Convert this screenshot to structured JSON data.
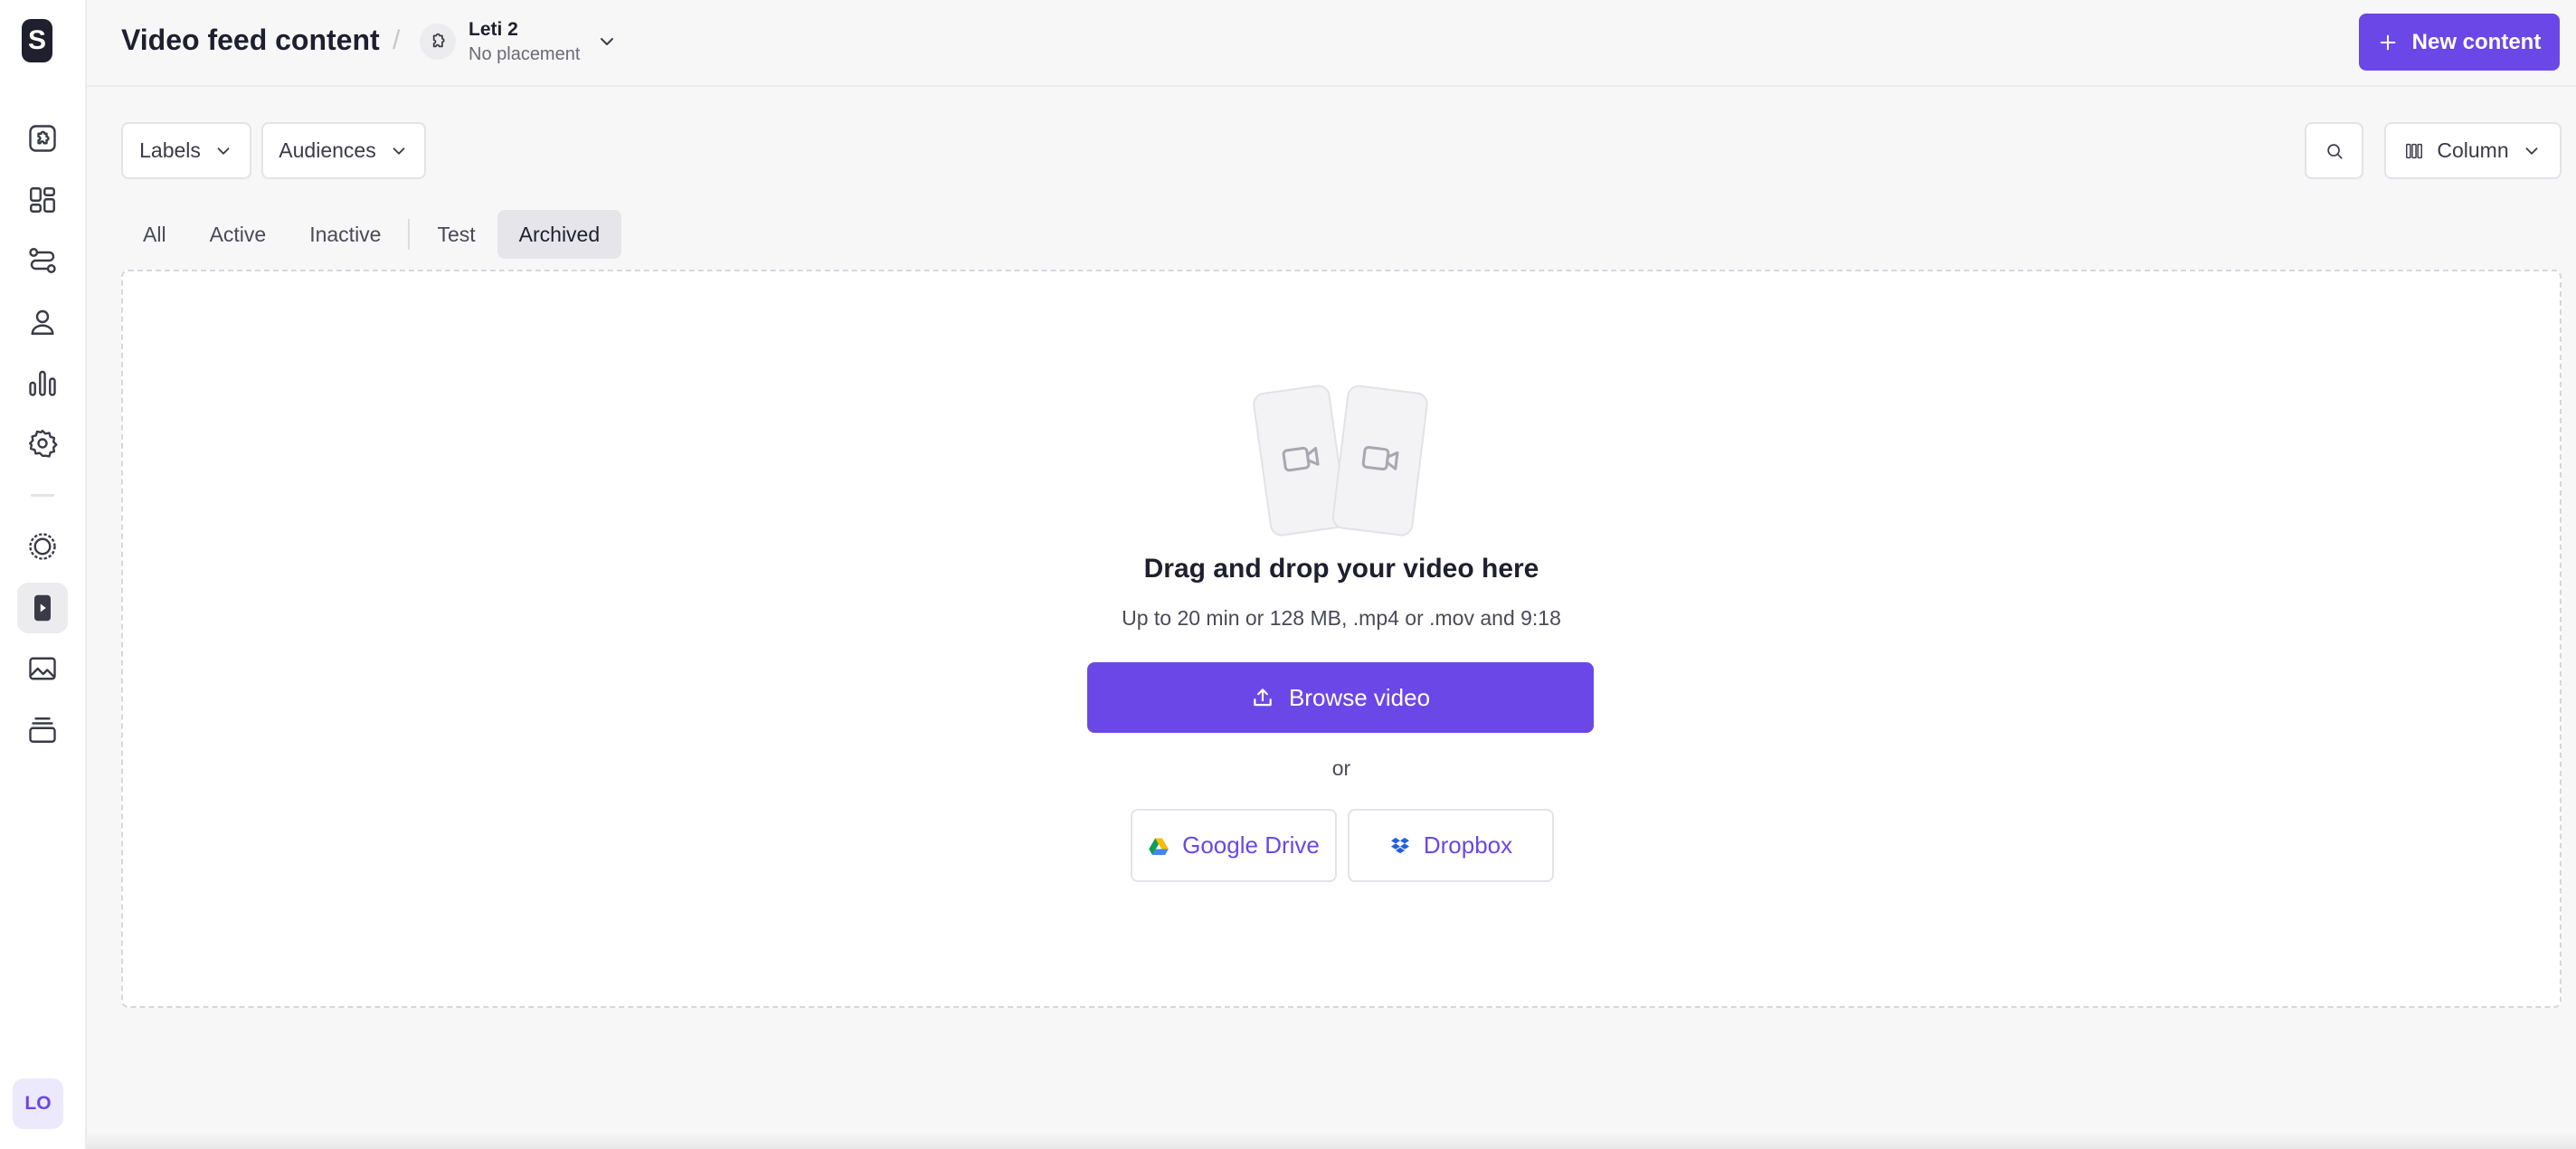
{
  "sidebar": {
    "logo_text": "S",
    "items": [
      {
        "icon": "puzzle-icon"
      },
      {
        "icon": "grid-layout-icon"
      },
      {
        "icon": "flow-icon"
      },
      {
        "icon": "user-icon"
      },
      {
        "icon": "bar-chart-icon"
      },
      {
        "icon": "gear-icon"
      },
      {
        "icon": "stories-icon"
      },
      {
        "icon": "video-feed-icon",
        "active": true
      },
      {
        "icon": "image-icon"
      },
      {
        "icon": "stack-icon"
      }
    ],
    "avatar_initials": "LO"
  },
  "header": {
    "title": "Video feed content",
    "separator": "/",
    "placement": {
      "name": "Leti 2",
      "subtitle": "No placement",
      "icon": "puzzle-icon"
    },
    "new_content_label": "New content"
  },
  "filters": {
    "labels_label": "Labels",
    "audiences_label": "Audiences",
    "view_label": "Column"
  },
  "tabs": [
    {
      "label": "All"
    },
    {
      "label": "Active"
    },
    {
      "label": "Inactive"
    },
    {
      "label": "Test"
    },
    {
      "label": "Archived",
      "active": true
    }
  ],
  "dropzone": {
    "title": "Drag and drop your video here",
    "subtitle": "Up to 20 min or 128 MB, .mp4 or .mov and 9:18",
    "browse_label": "Browse video",
    "or_label": "or",
    "google_drive_label": "Google Drive",
    "dropbox_label": "Dropbox"
  },
  "colors": {
    "accent": "#6b47e8",
    "background": "#f7f7f8",
    "text": "#1f1f2e"
  }
}
